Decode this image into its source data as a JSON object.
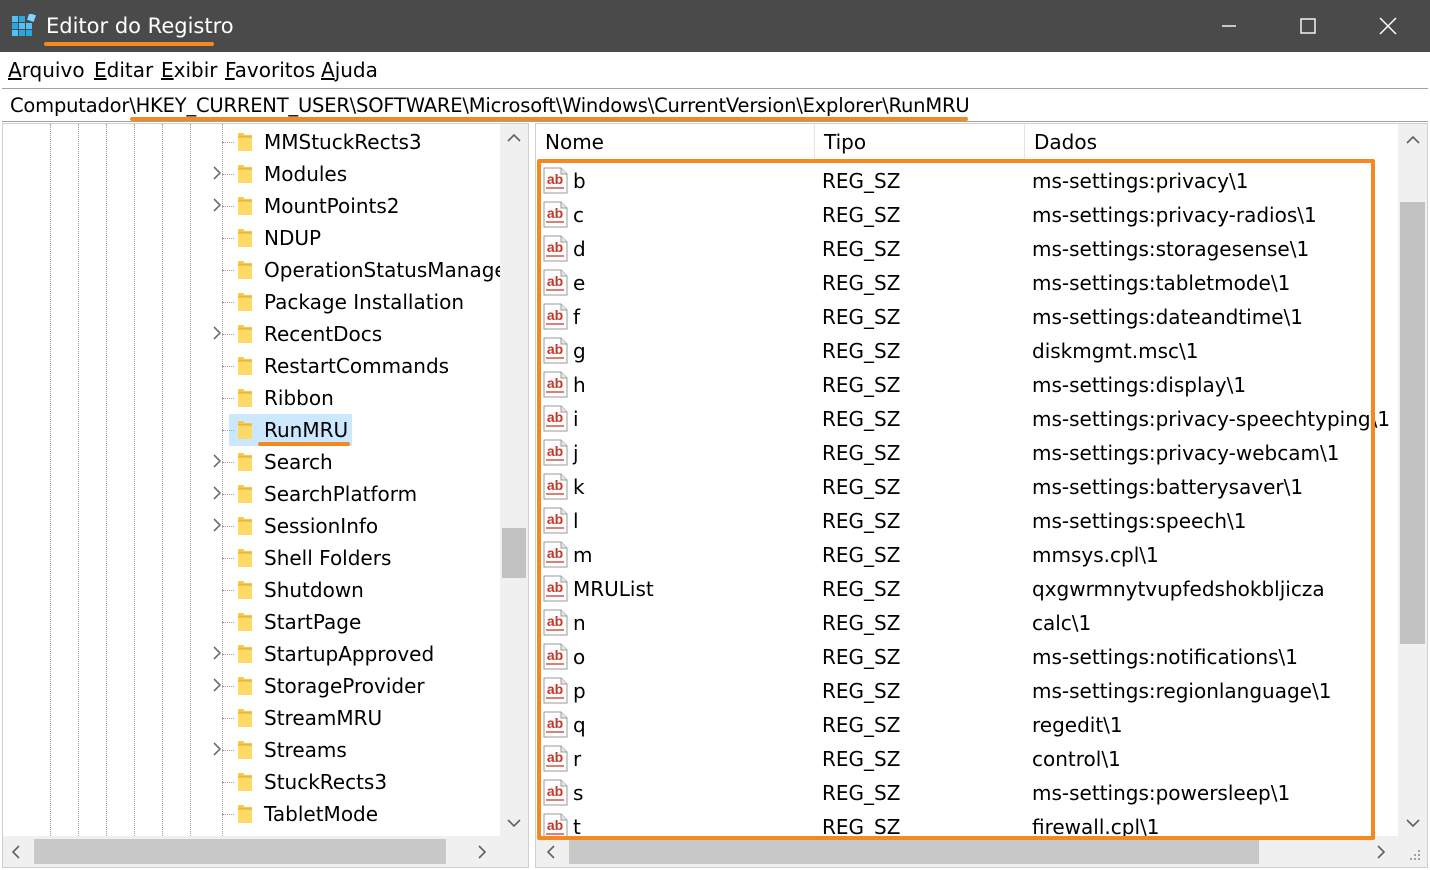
{
  "window": {
    "title": "Editor do Registro",
    "accent_color": "#f5891f",
    "titlebar_color": "#4a4a4a",
    "app_icon": "registry-icon"
  },
  "menu": {
    "items": [
      "Arquivo",
      "Editar",
      "Exibir",
      "Favoritos",
      "Ajuda"
    ]
  },
  "address": {
    "path": "Computador\\HKEY_CURRENT_USER\\SOFTWARE\\Microsoft\\Windows\\CurrentVersion\\Explorer\\RunMRU"
  },
  "tree": {
    "items": [
      {
        "label": "MMStuckRects3",
        "expandable": false,
        "selected": false
      },
      {
        "label": "Modules",
        "expandable": true,
        "selected": false
      },
      {
        "label": "MountPoints2",
        "expandable": true,
        "selected": false
      },
      {
        "label": "NDUP",
        "expandable": false,
        "selected": false
      },
      {
        "label": "OperationStatusManager",
        "expandable": false,
        "selected": false
      },
      {
        "label": "Package Installation",
        "expandable": false,
        "selected": false
      },
      {
        "label": "RecentDocs",
        "expandable": true,
        "selected": false
      },
      {
        "label": "RestartCommands",
        "expandable": false,
        "selected": false
      },
      {
        "label": "Ribbon",
        "expandable": false,
        "selected": false
      },
      {
        "label": "RunMRU",
        "expandable": false,
        "selected": true
      },
      {
        "label": "Search",
        "expandable": true,
        "selected": false
      },
      {
        "label": "SearchPlatform",
        "expandable": true,
        "selected": false
      },
      {
        "label": "SessionInfo",
        "expandable": true,
        "selected": false
      },
      {
        "label": "Shell Folders",
        "expandable": false,
        "selected": false
      },
      {
        "label": "Shutdown",
        "expandable": false,
        "selected": false
      },
      {
        "label": "StartPage",
        "expandable": false,
        "selected": false
      },
      {
        "label": "StartupApproved",
        "expandable": true,
        "selected": false
      },
      {
        "label": "StorageProvider",
        "expandable": true,
        "selected": false
      },
      {
        "label": "StreamMRU",
        "expandable": false,
        "selected": false
      },
      {
        "label": "Streams",
        "expandable": true,
        "selected": false
      },
      {
        "label": "StuckRects3",
        "expandable": false,
        "selected": false
      },
      {
        "label": "TabletMode",
        "expandable": false,
        "selected": false
      }
    ]
  },
  "list": {
    "columns": [
      "Nome",
      "Tipo",
      "Dados"
    ],
    "rows": [
      {
        "name": "b",
        "type": "REG_SZ",
        "data": "ms-settings:privacy\\1"
      },
      {
        "name": "c",
        "type": "REG_SZ",
        "data": "ms-settings:privacy-radios\\1"
      },
      {
        "name": "d",
        "type": "REG_SZ",
        "data": "ms-settings:storagesense\\1"
      },
      {
        "name": "e",
        "type": "REG_SZ",
        "data": "ms-settings:tabletmode\\1"
      },
      {
        "name": "f",
        "type": "REG_SZ",
        "data": "ms-settings:dateandtime\\1"
      },
      {
        "name": "g",
        "type": "REG_SZ",
        "data": "diskmgmt.msc\\1"
      },
      {
        "name": "h",
        "type": "REG_SZ",
        "data": "ms-settings:display\\1"
      },
      {
        "name": "i",
        "type": "REG_SZ",
        "data": "ms-settings:privacy-speechtyping\\1"
      },
      {
        "name": "j",
        "type": "REG_SZ",
        "data": "ms-settings:privacy-webcam\\1"
      },
      {
        "name": "k",
        "type": "REG_SZ",
        "data": "ms-settings:batterysaver\\1"
      },
      {
        "name": "l",
        "type": "REG_SZ",
        "data": "ms-settings:speech\\1"
      },
      {
        "name": "m",
        "type": "REG_SZ",
        "data": "mmsys.cpl\\1"
      },
      {
        "name": "MRUList",
        "type": "REG_SZ",
        "data": "qxgwrmnytvupfedshokbljicza"
      },
      {
        "name": "n",
        "type": "REG_SZ",
        "data": "calc\\1"
      },
      {
        "name": "o",
        "type": "REG_SZ",
        "data": "ms-settings:notifications\\1"
      },
      {
        "name": "p",
        "type": "REG_SZ",
        "data": "ms-settings:regionlanguage\\1"
      },
      {
        "name": "q",
        "type": "REG_SZ",
        "data": "regedit\\1"
      },
      {
        "name": "r",
        "type": "REG_SZ",
        "data": "control\\1"
      },
      {
        "name": "s",
        "type": "REG_SZ",
        "data": "ms-settings:powersleep\\1"
      },
      {
        "name": "t",
        "type": "REG_SZ",
        "data": "firewall.cpl\\1"
      }
    ]
  }
}
